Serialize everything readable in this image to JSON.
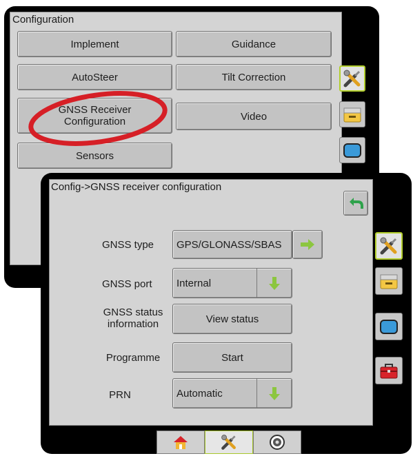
{
  "config_screen": {
    "title": "Configuration",
    "buttons": {
      "implement": "Implement",
      "guidance": "Guidance",
      "autosteer": "AutoSteer",
      "tilt_correction": "Tilt Correction",
      "gnss_receiver_line1": "GNSS Receiver",
      "gnss_receiver_line2": "Configuration",
      "video": "Video",
      "sensors": "Sensors"
    },
    "side_tabs": [
      "tools-icon",
      "console-icon",
      "display-icon"
    ],
    "highlight_color": "#d61f26"
  },
  "gnss_screen": {
    "title": "Config->GNSS receiver configuration",
    "rows": {
      "gnss_type": {
        "label": "GNSS type",
        "value": "GPS/GLONASS/SBAS"
      },
      "gnss_port": {
        "label": "GNSS port",
        "value": "Internal"
      },
      "gnss_status": {
        "label_line1": "GNSS status",
        "label_line2": "information",
        "button": "View status"
      },
      "programme": {
        "label": "Programme",
        "button": "Start"
      },
      "prn": {
        "label": "PRN",
        "value": "Automatic"
      }
    },
    "side_tabs": [
      "tools-icon",
      "console-icon",
      "display-icon",
      "toolbox-icon"
    ],
    "bottom_tabs": [
      "home-icon",
      "tools-icon",
      "gauge-icon"
    ],
    "active_tab": "tools-icon",
    "colors": {
      "accent_green": "#8cc63f",
      "active_border": "#b3cf2c"
    }
  }
}
